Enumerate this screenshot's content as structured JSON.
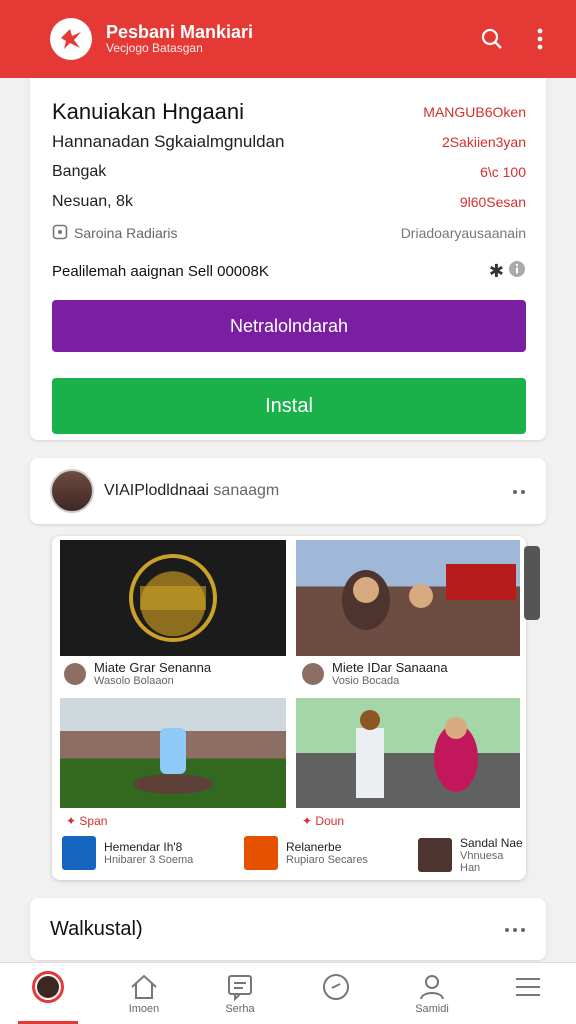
{
  "app": {
    "title": "Pesbani Mankiari",
    "subtitle": "Vecjogo Batasgan",
    "accent": "#e53935"
  },
  "details": {
    "title": "Kanuiakan Hngaani",
    "title_right": "MANGUB6Oken",
    "subtitle": "Hannanadan Sgkaialmgnuldan",
    "subtitle_right": "2Sakiien3yan",
    "row1_label": "Bangak",
    "row1_value": "6\\c 100",
    "row2_label": "Nesuan, 8k",
    "row2_value": "9l60Sesan",
    "note_label": "Saroina Radiaris",
    "note_value": "Driadoaryausaanain",
    "footer_text": "Pealilemah aaignan Sell 00008K",
    "purple_button": "Netralolndarah",
    "green_button": "Instal"
  },
  "profile": {
    "name": "VIAIPlodldnaai",
    "handle": "sanaagm"
  },
  "gallery": {
    "tiles": [
      {
        "caption": "Miate Grar Senanna",
        "sub": "Wasolo Bolaaon"
      },
      {
        "caption": "Miete IDar Sanaana",
        "sub": "Vosio Bocada"
      }
    ],
    "tag_left": "Span",
    "tag_right": "Doun",
    "strip": [
      {
        "title": "Hemendar Ih'8",
        "sub": "Hnibarer 3 Soema"
      },
      {
        "title": "Relanerbe",
        "sub": "Rupiaro Secares"
      },
      {
        "title": "Sandal Nae",
        "sub": "Vhnuesa Han"
      }
    ]
  },
  "bottom_card": {
    "title": "Walkustal)"
  },
  "nav": {
    "items": [
      {
        "label": ""
      },
      {
        "label": "Imoen"
      },
      {
        "label": "Serha"
      },
      {
        "label": ""
      },
      {
        "label": "Samidi"
      },
      {
        "label": ""
      }
    ]
  }
}
